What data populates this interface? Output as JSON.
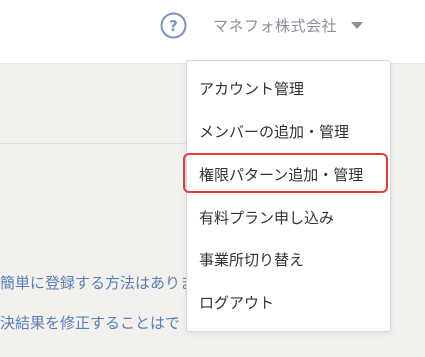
{
  "header": {
    "help_icon": "question-circle-icon",
    "company_name": "マネフォ株式会社",
    "dropdown_icon": "caret-down-icon"
  },
  "faq": {
    "items": [
      "簡単に登録する方法はありま",
      "決結果を修正することはで"
    ]
  },
  "dropdown": {
    "items": [
      "アカウント管理",
      "メンバーの追加・管理",
      "権限パターン追加・管理",
      "有料プラン申し込み",
      "事業所切り替え",
      "ログアウト"
    ],
    "highlighted_index": 2
  },
  "colors": {
    "help_icon": "#7b92c5",
    "link": "#5b7fb6",
    "highlight_border": "#e53a3a"
  }
}
